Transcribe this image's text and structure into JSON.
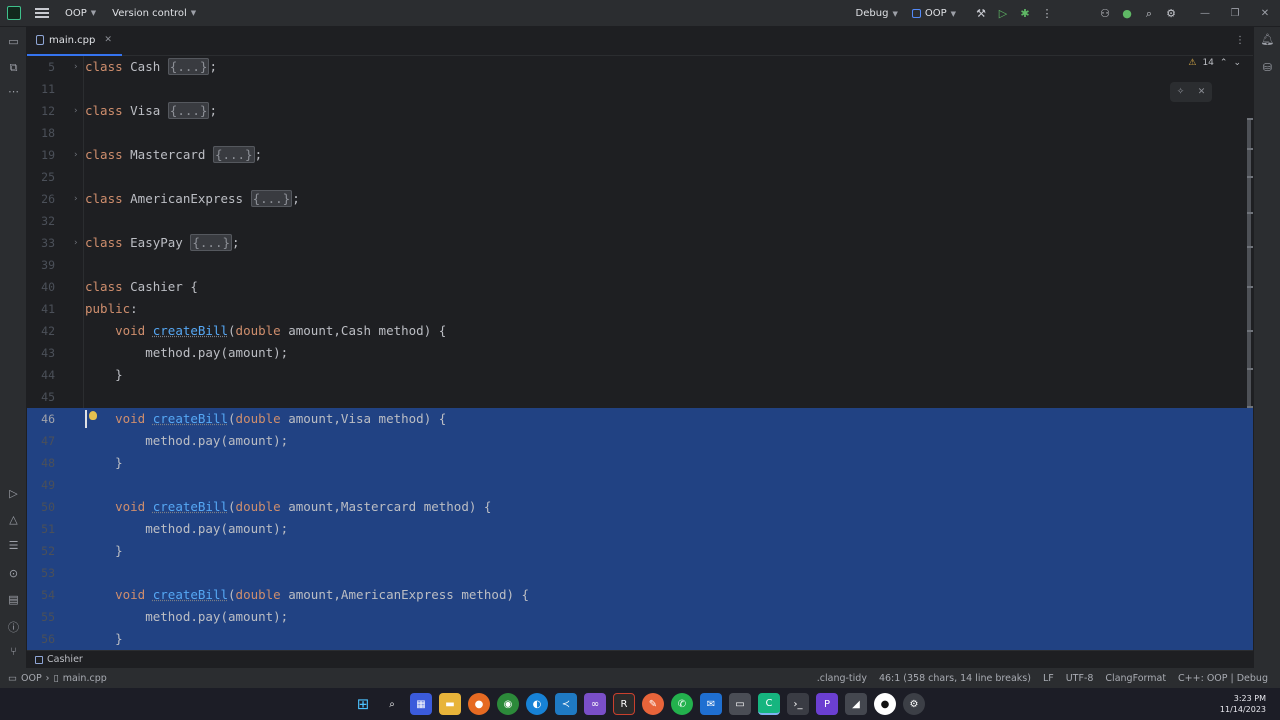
{
  "titlebar": {
    "project": "OOP",
    "vcs": "Version control",
    "run_config": "Debug",
    "target": "OOP"
  },
  "tab": {
    "filename": "main.cpp"
  },
  "inspections": {
    "warnings": "14"
  },
  "code_lines": [
    {
      "n": "5",
      "parts": [
        [
          "kw",
          "class "
        ],
        [
          "t",
          "Cash "
        ],
        [
          "ph",
          "{...}"
        ],
        [
          "t",
          ";"
        ]
      ],
      "fold": true
    },
    {
      "n": "11",
      "parts": []
    },
    {
      "n": "12",
      "parts": [
        [
          "kw",
          "class "
        ],
        [
          "t",
          "Visa "
        ],
        [
          "ph",
          "{...}"
        ],
        [
          "t",
          ";"
        ]
      ],
      "fold": true
    },
    {
      "n": "18",
      "parts": []
    },
    {
      "n": "19",
      "parts": [
        [
          "kw",
          "class "
        ],
        [
          "t",
          "Mastercard "
        ],
        [
          "ph",
          "{...}"
        ],
        [
          "t",
          ";"
        ]
      ],
      "fold": true
    },
    {
      "n": "25",
      "parts": []
    },
    {
      "n": "26",
      "parts": [
        [
          "kw",
          "class "
        ],
        [
          "t",
          "AmericanExpress "
        ],
        [
          "ph",
          "{...}"
        ],
        [
          "t",
          ";"
        ]
      ],
      "fold": true
    },
    {
      "n": "32",
      "parts": []
    },
    {
      "n": "33",
      "parts": [
        [
          "kw",
          "class "
        ],
        [
          "t",
          "EasyPay "
        ],
        [
          "ph",
          "{...}"
        ],
        [
          "t",
          ";"
        ]
      ],
      "fold": true
    },
    {
      "n": "39",
      "parts": []
    },
    {
      "n": "40",
      "parts": [
        [
          "kw",
          "class "
        ],
        [
          "t",
          "Cashier {"
        ]
      ]
    },
    {
      "n": "41",
      "parts": [
        [
          "kw",
          "public"
        ],
        [
          "t",
          ":"
        ]
      ]
    },
    {
      "n": "42",
      "parts": [
        [
          "t",
          "    "
        ],
        [
          "kw",
          "void "
        ],
        [
          "fn",
          "createBill"
        ],
        [
          "t",
          "("
        ],
        [
          "kw",
          "double "
        ],
        [
          "t",
          "amount,Cash method) {"
        ]
      ]
    },
    {
      "n": "43",
      "parts": [
        [
          "t",
          "        method.pay(amount);"
        ]
      ]
    },
    {
      "n": "44",
      "parts": [
        [
          "t",
          "    }"
        ]
      ]
    },
    {
      "n": "45",
      "parts": []
    },
    {
      "n": "46",
      "parts": [
        [
          "t",
          "    "
        ],
        [
          "kw",
          "void "
        ],
        [
          "fn",
          "createBill"
        ],
        [
          "t",
          "("
        ],
        [
          "kw",
          "double "
        ],
        [
          "t",
          "amount,Visa method) {"
        ]
      ],
      "sel": true,
      "cur": true
    },
    {
      "n": "47",
      "parts": [
        [
          "t",
          "        method.pay(amount);"
        ]
      ],
      "sel": true
    },
    {
      "n": "48",
      "parts": [
        [
          "t",
          "    }"
        ]
      ],
      "sel": true
    },
    {
      "n": "49",
      "parts": [],
      "sel": true
    },
    {
      "n": "50",
      "parts": [
        [
          "t",
          "    "
        ],
        [
          "kw",
          "void "
        ],
        [
          "fn",
          "createBill"
        ],
        [
          "t",
          "("
        ],
        [
          "kw",
          "double "
        ],
        [
          "t",
          "amount,Mastercard method) {"
        ]
      ],
      "sel": true
    },
    {
      "n": "51",
      "parts": [
        [
          "t",
          "        method.pay(amount);"
        ]
      ],
      "sel": true
    },
    {
      "n": "52",
      "parts": [
        [
          "t",
          "    }"
        ]
      ],
      "sel": true
    },
    {
      "n": "53",
      "parts": [],
      "sel": true
    },
    {
      "n": "54",
      "parts": [
        [
          "t",
          "    "
        ],
        [
          "kw",
          "void "
        ],
        [
          "fn",
          "createBill"
        ],
        [
          "t",
          "("
        ],
        [
          "kw",
          "double "
        ],
        [
          "t",
          "amount,AmericanExpress method) {"
        ]
      ],
      "sel": true
    },
    {
      "n": "55",
      "parts": [
        [
          "t",
          "        method.pay(amount);"
        ]
      ],
      "sel": true
    },
    {
      "n": "56",
      "parts": [
        [
          "t",
          "    }"
        ]
      ],
      "sel": true
    }
  ],
  "breadcrumb": {
    "symbol": "Cashier"
  },
  "status": {
    "project": "OOP",
    "file": "main.cpp",
    "linter": ".clang-tidy",
    "position": "46:1 (358 chars, 14 line breaks)",
    "line_sep": "LF",
    "encoding": "UTF-8",
    "formatter": "ClangFormat",
    "context": "C++: OOP | Debug"
  },
  "clock": {
    "time": "3:23 PM",
    "date": "11/14/2023"
  },
  "colors": {
    "selection": "#214283",
    "keyword": "#cf8e6d",
    "function": "#56a8f5",
    "accent": "#3574f0"
  }
}
